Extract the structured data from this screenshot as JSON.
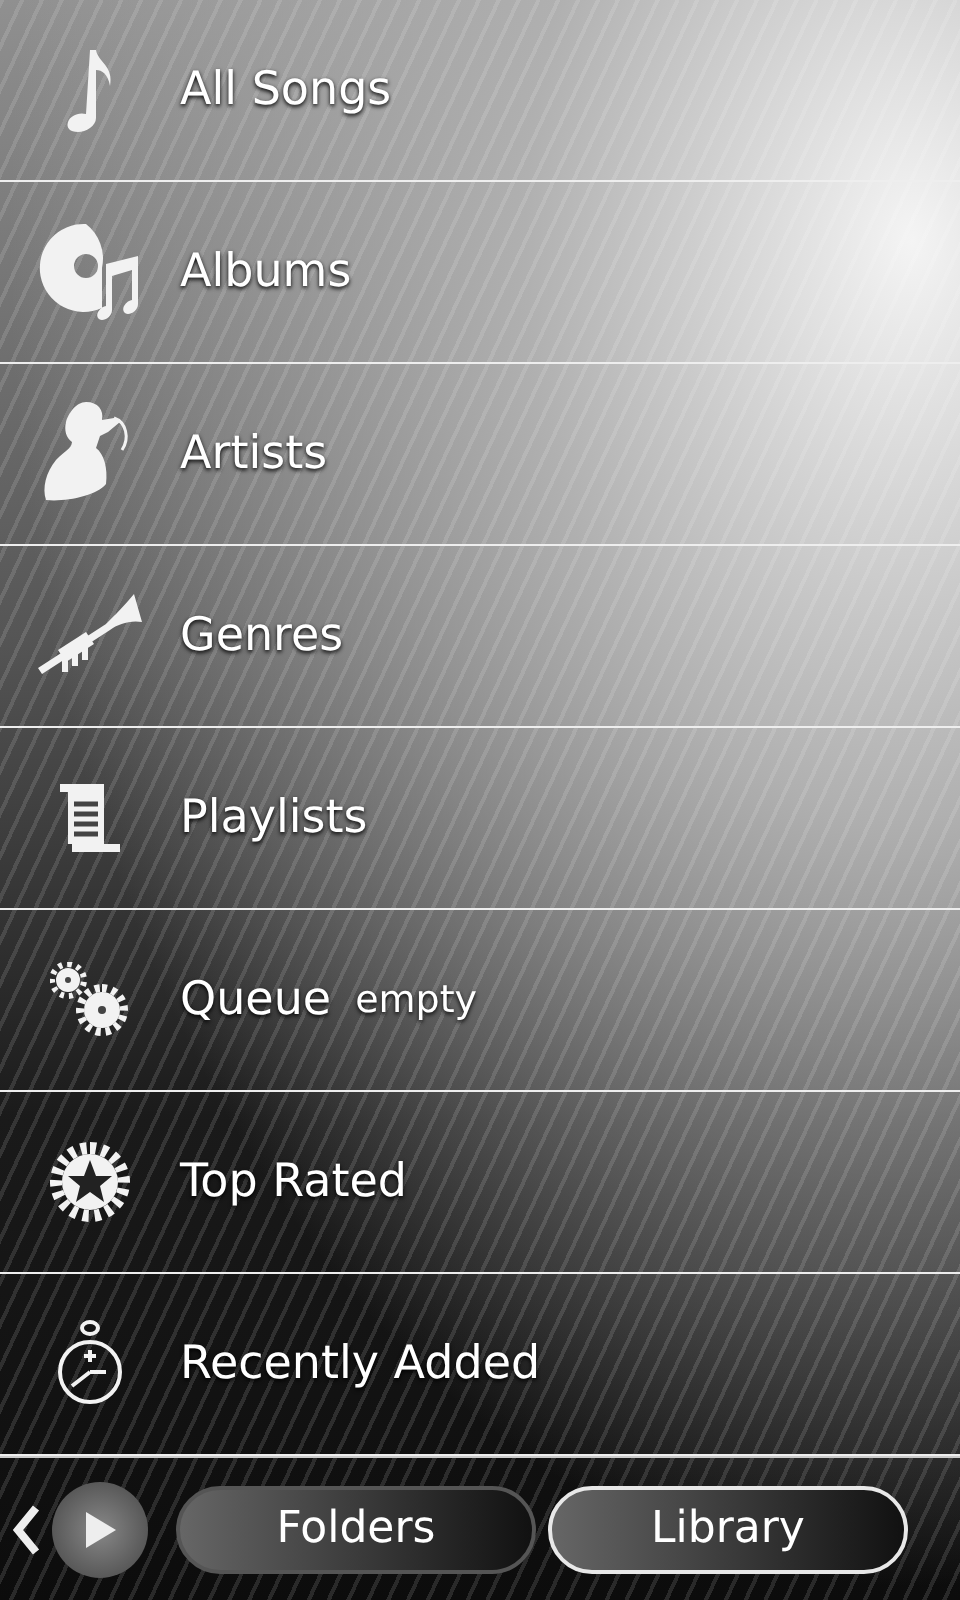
{
  "menu": [
    {
      "kind": "note",
      "label": "All Songs"
    },
    {
      "kind": "disc",
      "label": "Albums"
    },
    {
      "kind": "singer",
      "label": "Artists"
    },
    {
      "kind": "trumpet",
      "label": "Genres"
    },
    {
      "kind": "scroll",
      "label": "Playlists"
    },
    {
      "kind": "gears",
      "label": "Queue",
      "status": "empty"
    },
    {
      "kind": "star",
      "label": "Top Rated"
    },
    {
      "kind": "stopwatch",
      "label": "Recently Added"
    }
  ],
  "tabs": [
    {
      "label": "Folders",
      "selected": false
    },
    {
      "label": "Library",
      "selected": true
    }
  ]
}
